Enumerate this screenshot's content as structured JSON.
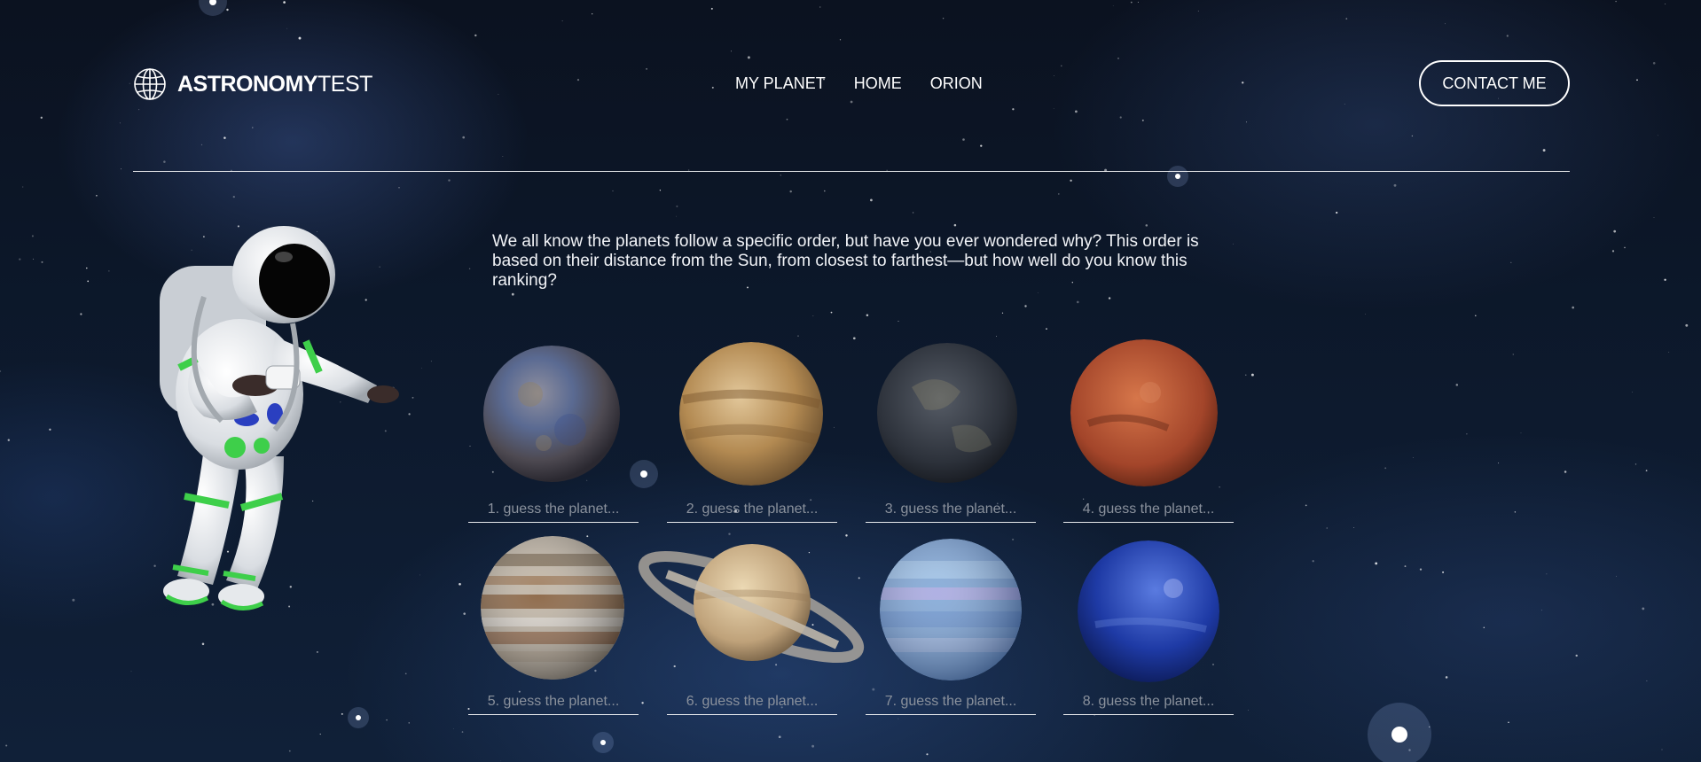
{
  "header": {
    "logo_icon": "globe-icon",
    "logo_strong": "ASTRONOMY",
    "logo_light": "TEST",
    "nav": [
      "MY PLANET",
      "HOME",
      "ORION"
    ],
    "contact_label": "CONTACT ME"
  },
  "intro": {
    "text": "We all know the planets follow a specific order, but have you ever wondered why? This order is based on their distance from the Sun, from closest to farthest—but how well do you know this ranking?"
  },
  "quiz": {
    "inputs": [
      {
        "placeholder": "1. guess the planet..."
      },
      {
        "placeholder": "2. guess the planet..."
      },
      {
        "placeholder": "3. guess the planet..."
      },
      {
        "placeholder": "4. guess the planet..."
      },
      {
        "placeholder": "5. guess the planet..."
      },
      {
        "placeholder": "6. guess the planet..."
      },
      {
        "placeholder": "7. guess the planet..."
      },
      {
        "placeholder": "8. guess the planet..."
      }
    ]
  },
  "colors": {
    "background": "#0d1a2e",
    "text": "#ffffff",
    "placeholder": "#8a919c",
    "astronaut_accent": "#3ecf4a"
  }
}
